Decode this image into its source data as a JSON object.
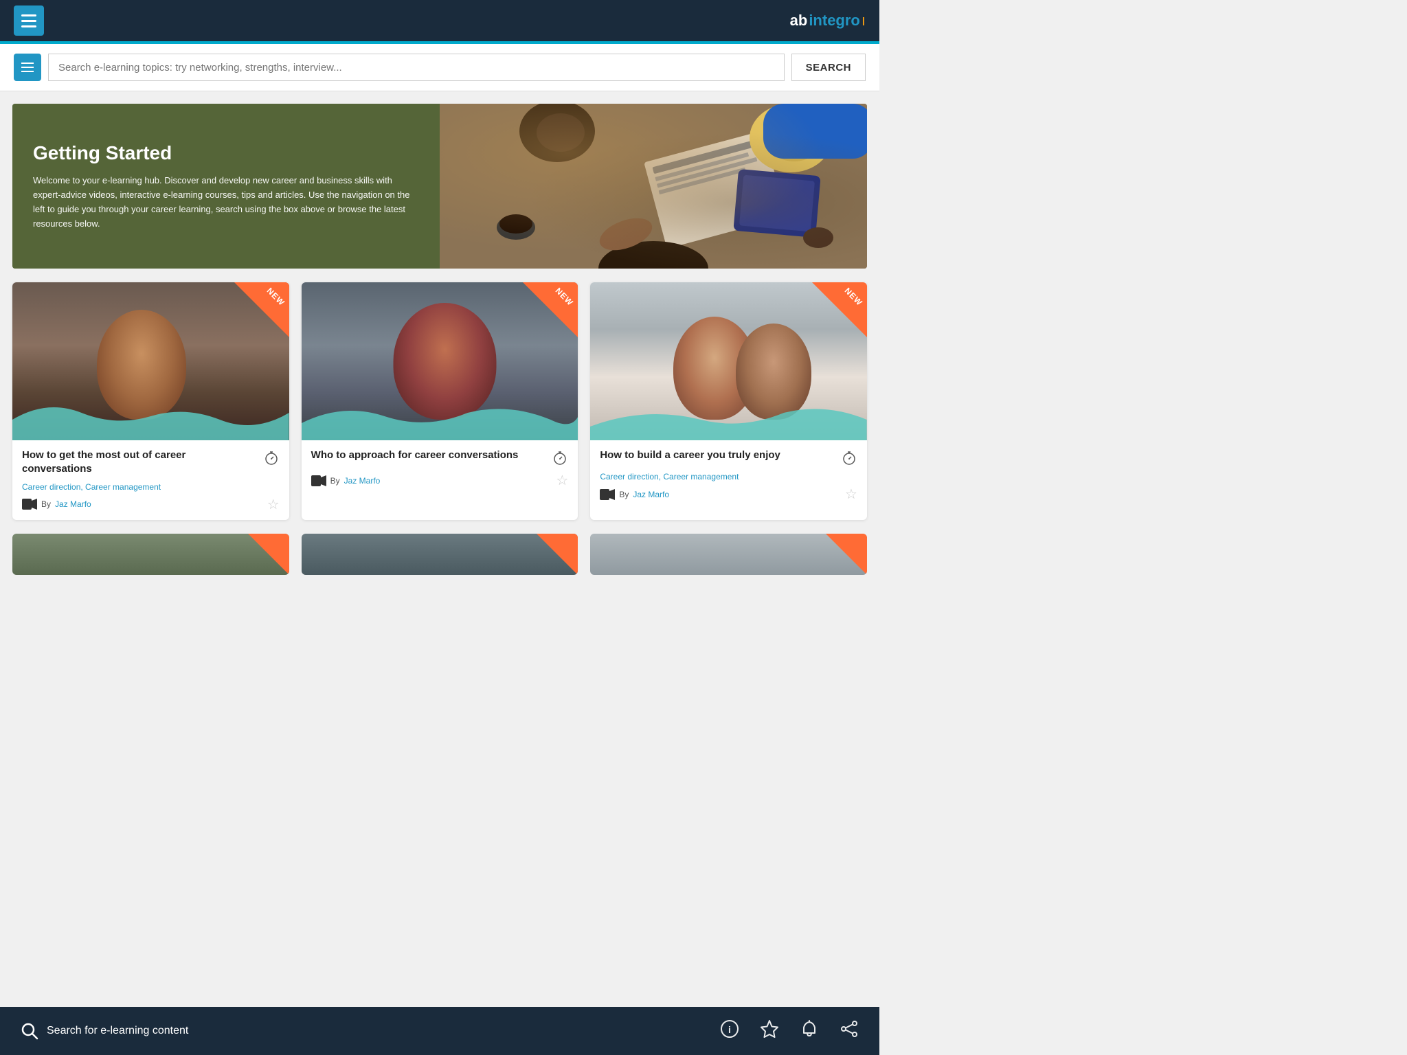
{
  "app": {
    "title": "abintegro",
    "logo_ab": "ab",
    "logo_integro": "integro",
    "logo_suffix": "ı"
  },
  "topnav": {
    "hamburger_label": "Menu"
  },
  "search": {
    "placeholder": "Search e-learning topics: try networking, strengths, interview...",
    "button_label": "SEARCH",
    "bottom_placeholder": "Search for e-learning content"
  },
  "hero": {
    "title": "Getting Started",
    "description": "Welcome to your e-learning hub. Discover and develop new career and business skills with expert-advice videos, interactive e-learning courses, tips and articles. Use the navigation on the left to guide you through your career learning, search using the box above or browse the latest resources below."
  },
  "cards": [
    {
      "id": "card-1",
      "title": "How to get the most out of career conversations",
      "tags": "Career direction, Career management",
      "author": "Jaz Marfo",
      "is_new": true,
      "badge_text": "NEW"
    },
    {
      "id": "card-2",
      "title": "Who to approach for career conversations",
      "tags": "",
      "author": "Jaz Marfo",
      "is_new": true,
      "badge_text": "NEW"
    },
    {
      "id": "card-3",
      "title": "How to build a career you truly enjoy",
      "tags": "Career direction, Career management",
      "author": "Jaz Marfo",
      "is_new": true,
      "badge_text": "NEW"
    }
  ],
  "bottom_nav": {
    "search_label": "Search for e-learning content",
    "icons": [
      "info-icon",
      "star-icon",
      "bell-icon",
      "share-icon"
    ]
  }
}
